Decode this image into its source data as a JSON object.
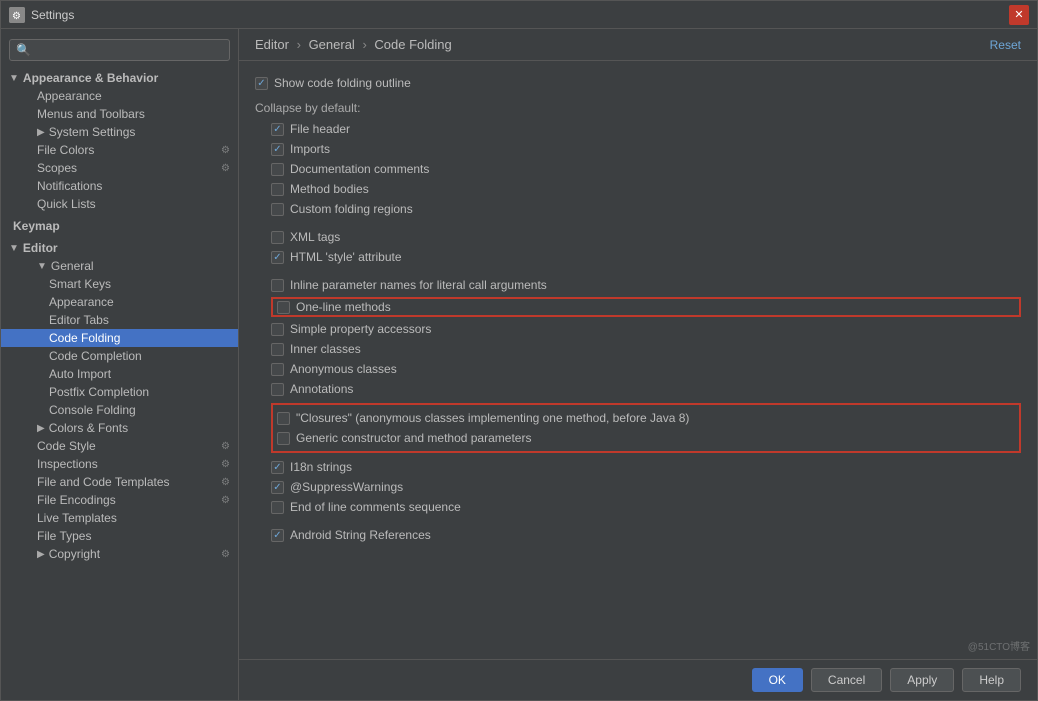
{
  "window": {
    "title": "Settings",
    "close_label": "✕"
  },
  "search": {
    "placeholder": ""
  },
  "sidebar": {
    "sections": [
      {
        "id": "appearance-behavior",
        "label": "Appearance & Behavior",
        "expanded": true,
        "items": [
          {
            "id": "appearance",
            "label": "Appearance",
            "indent": 2
          },
          {
            "id": "menus-toolbars",
            "label": "Menus and Toolbars",
            "indent": 2
          },
          {
            "id": "system-settings",
            "label": "System Settings",
            "indent": 2,
            "arrow": true
          },
          {
            "id": "file-colors",
            "label": "File Colors",
            "indent": 2,
            "icon": "⚙"
          },
          {
            "id": "scopes",
            "label": "Scopes",
            "indent": 2,
            "icon": "⚙"
          },
          {
            "id": "notifications",
            "label": "Notifications",
            "indent": 2
          },
          {
            "id": "quick-lists",
            "label": "Quick Lists",
            "indent": 2
          }
        ]
      },
      {
        "id": "keymap",
        "label": "Keymap",
        "expanded": false,
        "items": []
      },
      {
        "id": "editor",
        "label": "Editor",
        "expanded": true,
        "items": [
          {
            "id": "general",
            "label": "General",
            "indent": 2,
            "expanded": true,
            "arrow": true
          },
          {
            "id": "smart-keys",
            "label": "Smart Keys",
            "indent": 3
          },
          {
            "id": "appearance-editor",
            "label": "Appearance",
            "indent": 3
          },
          {
            "id": "editor-tabs",
            "label": "Editor Tabs",
            "indent": 3
          },
          {
            "id": "code-folding",
            "label": "Code Folding",
            "indent": 3,
            "active": true
          },
          {
            "id": "code-completion",
            "label": "Code Completion",
            "indent": 3
          },
          {
            "id": "auto-import",
            "label": "Auto Import",
            "indent": 3
          },
          {
            "id": "postfix-completion",
            "label": "Postfix Completion",
            "indent": 3
          },
          {
            "id": "console-folding",
            "label": "Console Folding",
            "indent": 3
          },
          {
            "id": "colors-fonts",
            "label": "Colors & Fonts",
            "indent": 2,
            "arrow": true
          },
          {
            "id": "code-style",
            "label": "Code Style",
            "indent": 2,
            "icon": "⚙"
          },
          {
            "id": "inspections",
            "label": "Inspections",
            "indent": 2,
            "icon": "⚙"
          },
          {
            "id": "file-code-templates",
            "label": "File and Code Templates",
            "indent": 2,
            "icon": "⚙"
          },
          {
            "id": "file-encodings",
            "label": "File Encodings",
            "indent": 2,
            "icon": "⚙"
          },
          {
            "id": "live-templates",
            "label": "Live Templates",
            "indent": 2
          },
          {
            "id": "file-types",
            "label": "File Types",
            "indent": 2
          },
          {
            "id": "copyright",
            "label": "Copyright",
            "indent": 2,
            "arrow": true
          }
        ]
      }
    ]
  },
  "breadcrumb": {
    "parts": [
      "Editor",
      "General",
      "Code Folding"
    ]
  },
  "reset_label": "Reset",
  "content": {
    "show_outline": {
      "label": "Show code folding outline",
      "checked": true
    },
    "collapse_default_label": "Collapse by default:",
    "options": [
      {
        "id": "file-header",
        "label": "File header",
        "checked": true
      },
      {
        "id": "imports",
        "label": "Imports",
        "checked": true
      },
      {
        "id": "doc-comments",
        "label": "Documentation comments",
        "checked": false
      },
      {
        "id": "method-bodies",
        "label": "Method bodies",
        "checked": false
      },
      {
        "id": "custom-folding",
        "label": "Custom folding regions",
        "checked": false
      },
      {
        "id": "spacer1",
        "spacer": true
      },
      {
        "id": "xml-tags",
        "label": "XML tags",
        "checked": false
      },
      {
        "id": "html-style",
        "label": "HTML 'style' attribute",
        "checked": true
      },
      {
        "id": "spacer2",
        "spacer": true
      },
      {
        "id": "inline-params",
        "label": "Inline parameter names for literal call arguments",
        "checked": false
      },
      {
        "id": "one-line-methods",
        "label": "One-line methods",
        "checked": false,
        "highlighted": true
      },
      {
        "id": "simple-property",
        "label": "Simple property accessors",
        "checked": false
      },
      {
        "id": "inner-classes",
        "label": "Inner classes",
        "checked": false
      },
      {
        "id": "anonymous-classes",
        "label": "Anonymous classes",
        "checked": false
      },
      {
        "id": "annotations",
        "label": "Annotations",
        "checked": false
      },
      {
        "id": "closures",
        "label": "\"Closures\" (anonymous classes implementing one method, before Java 8)",
        "checked": false,
        "highlight_group_start": true
      },
      {
        "id": "generic-constructor",
        "label": "Generic constructor and method parameters",
        "checked": false,
        "highlight_group_end": true
      },
      {
        "id": "i18n",
        "label": "I18n strings",
        "checked": true
      },
      {
        "id": "suppress-warnings",
        "label": "@SuppressWarnings",
        "checked": true
      },
      {
        "id": "end-of-line",
        "label": "End of line comments sequence",
        "checked": false
      },
      {
        "id": "spacer3",
        "spacer": true
      },
      {
        "id": "android-string",
        "label": "Android String References",
        "checked": true
      }
    ]
  },
  "footer": {
    "ok_label": "OK",
    "cancel_label": "Cancel",
    "apply_label": "Apply",
    "help_label": "Help"
  },
  "watermark": "@51CTO博客"
}
